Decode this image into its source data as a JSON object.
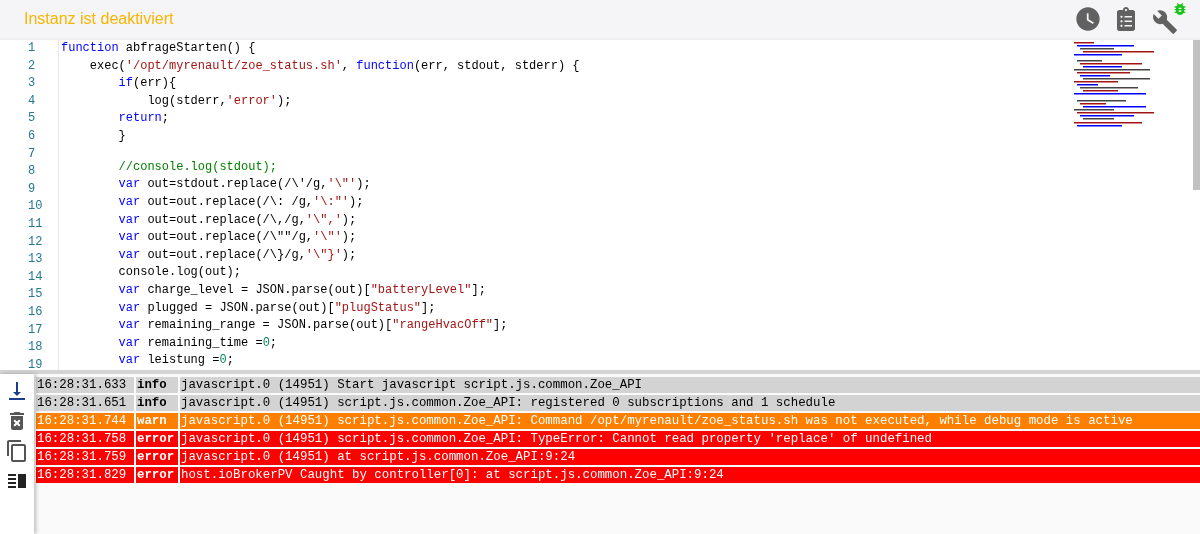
{
  "header": {
    "title": "Instanz ist deaktiviert"
  },
  "editor": {
    "lines": [
      {
        "number": "1",
        "tokens": [
          {
            "kind": "keyword",
            "text": "function"
          },
          {
            "kind": "plain",
            "text": " abfrageStarten() {"
          }
        ],
        "children": [
          {
            "number": "2",
            "tokens": [
              {
                "kind": "plain",
                "text": "exec("
              },
              {
                "kind": "string",
                "text": "'/opt/myrenault/zoe_status.sh'"
              },
              {
                "kind": "plain",
                "text": ", "
              },
              {
                "kind": "keyword",
                "text": "function"
              },
              {
                "kind": "plain",
                "text": "(err, stdout, stderr) {"
              }
            ],
            "children": [
              {
                "number": "3",
                "tokens": [
                  {
                    "kind": "keyword",
                    "text": "if"
                  },
                  {
                    "kind": "plain",
                    "text": "(err){"
                  }
                ],
                "children": [
                  {
                    "number": "4",
                    "tokens": [
                      {
                        "kind": "plain",
                        "text": "log(stderr,"
                      },
                      {
                        "kind": "string",
                        "text": "'error'"
                      },
                      {
                        "kind": "plain",
                        "text": ");"
                      }
                    ]
                  }
                ]
              },
              {
                "number": "5",
                "tokens": [
                  {
                    "kind": "keyword",
                    "text": "return"
                  },
                  {
                    "kind": "plain",
                    "text": ";"
                  }
                ]
              },
              {
                "number": "6",
                "tokens": [
                  {
                    "kind": "plain",
                    "text": "}"
                  }
                ]
              },
              {
                "number": "7"
              },
              {
                "number": "8",
                "tokens": [
                  {
                    "kind": "comment",
                    "text": "//console.log(stdout);"
                  }
                ]
              },
              {
                "number": "9",
                "tokens": [
                  {
                    "kind": "keyword",
                    "text": "var"
                  },
                  {
                    "kind": "plain",
                    "text": " out=stdout.replace(/\\'/g,"
                  },
                  {
                    "kind": "string",
                    "text": "'\\\"'"
                  },
                  {
                    "kind": "plain",
                    "text": ");"
                  }
                ]
              },
              {
                "number": "10",
                "tokens": [
                  {
                    "kind": "keyword",
                    "text": "var"
                  },
                  {
                    "kind": "plain",
                    "text": " out=out.replace(/\\: /g,"
                  },
                  {
                    "kind": "string",
                    "text": "'\\:\"'"
                  },
                  {
                    "kind": "plain",
                    "text": ");"
                  }
                ]
              },
              {
                "number": "11",
                "tokens": [
                  {
                    "kind": "keyword",
                    "text": "var"
                  },
                  {
                    "kind": "plain",
                    "text": " out=out.replace(/\\,/g,"
                  },
                  {
                    "kind": "string",
                    "text": "'\\\",'"
                  },
                  {
                    "kind": "plain",
                    "text": ");"
                  }
                ]
              },
              {
                "number": "12",
                "tokens": [
                  {
                    "kind": "keyword",
                    "text": "var"
                  },
                  {
                    "kind": "plain",
                    "text": " out=out.replace(/\\\"\"/g,"
                  },
                  {
                    "kind": "string",
                    "text": "'\\\"'"
                  },
                  {
                    "kind": "plain",
                    "text": ");"
                  }
                ]
              },
              {
                "number": "13",
                "tokens": [
                  {
                    "kind": "keyword",
                    "text": "var"
                  },
                  {
                    "kind": "plain",
                    "text": " out=out.replace(/\\}/g,"
                  },
                  {
                    "kind": "string",
                    "text": "'\\\"}'"
                  },
                  {
                    "kind": "plain",
                    "text": ");"
                  }
                ]
              },
              {
                "number": "14",
                "tokens": [
                  {
                    "kind": "plain",
                    "text": "console.log(out);"
                  }
                ]
              },
              {
                "number": "15",
                "tokens": [
                  {
                    "kind": "keyword",
                    "text": "var"
                  },
                  {
                    "kind": "plain",
                    "text": " charge_level = JSON.parse(out)["
                  },
                  {
                    "kind": "string",
                    "text": "\"batteryLevel\""
                  },
                  {
                    "kind": "plain",
                    "text": "];"
                  }
                ]
              },
              {
                "number": "16",
                "tokens": [
                  {
                    "kind": "keyword",
                    "text": "var"
                  },
                  {
                    "kind": "plain",
                    "text": " plugged = JSON.parse(out)["
                  },
                  {
                    "kind": "string",
                    "text": "\"plugStatus\""
                  },
                  {
                    "kind": "plain",
                    "text": "];"
                  }
                ]
              },
              {
                "number": "17",
                "tokens": [
                  {
                    "kind": "keyword",
                    "text": "var"
                  },
                  {
                    "kind": "plain",
                    "text": " remaining_range = JSON.parse(out)["
                  },
                  {
                    "kind": "string",
                    "text": "\"rangeHvacOff\""
                  },
                  {
                    "kind": "plain",
                    "text": "];"
                  }
                ]
              },
              {
                "number": "18",
                "tokens": [
                  {
                    "kind": "keyword",
                    "text": "var"
                  },
                  {
                    "kind": "plain",
                    "text": " remaining_time ="
                  },
                  {
                    "kind": "number",
                    "text": "0"
                  },
                  {
                    "kind": "plain",
                    "text": ";"
                  }
                ]
              },
              {
                "number": "19",
                "tokens": [
                  {
                    "kind": "keyword",
                    "text": "var"
                  },
                  {
                    "kind": "plain",
                    "text": " leistung ="
                  },
                  {
                    "kind": "number",
                    "text": "0"
                  },
                  {
                    "kind": "plain",
                    "text": ";"
                  }
                ]
              }
            ]
          }
        ]
      }
    ]
  },
  "log": {
    "rows": [
      {
        "time": "16:28:31.633",
        "level": "info",
        "message": "javascript.0 (14951) Start javascript script.js.common.Zoe_API"
      },
      {
        "time": "16:28:31.651",
        "level": "info",
        "message": "javascript.0 (14951) script.js.common.Zoe_API: registered 0 subscriptions and 1 schedule"
      },
      {
        "time": "16:28:31.744",
        "level": "warn",
        "message": "javascript.0 (14951) script.js.common.Zoe_API: Command /opt/myrenault/zoe_status.sh was not executed, while debug mode is active"
      },
      {
        "time": "16:28:31.758",
        "level": "error",
        "message": "javascript.0 (14951) script.js.common.Zoe_API: TypeError: Cannot read property 'replace' of undefined"
      },
      {
        "time": "16:28:31.759",
        "level": "error",
        "message": "javascript.0 (14951) at script.js.common.Zoe_API:9:24"
      },
      {
        "time": "16:28:31.829",
        "level": "error",
        "message": "host.ioBrokerPV Caught by controller[0]: at script.js.common.Zoe_API:9:24"
      }
    ]
  }
}
